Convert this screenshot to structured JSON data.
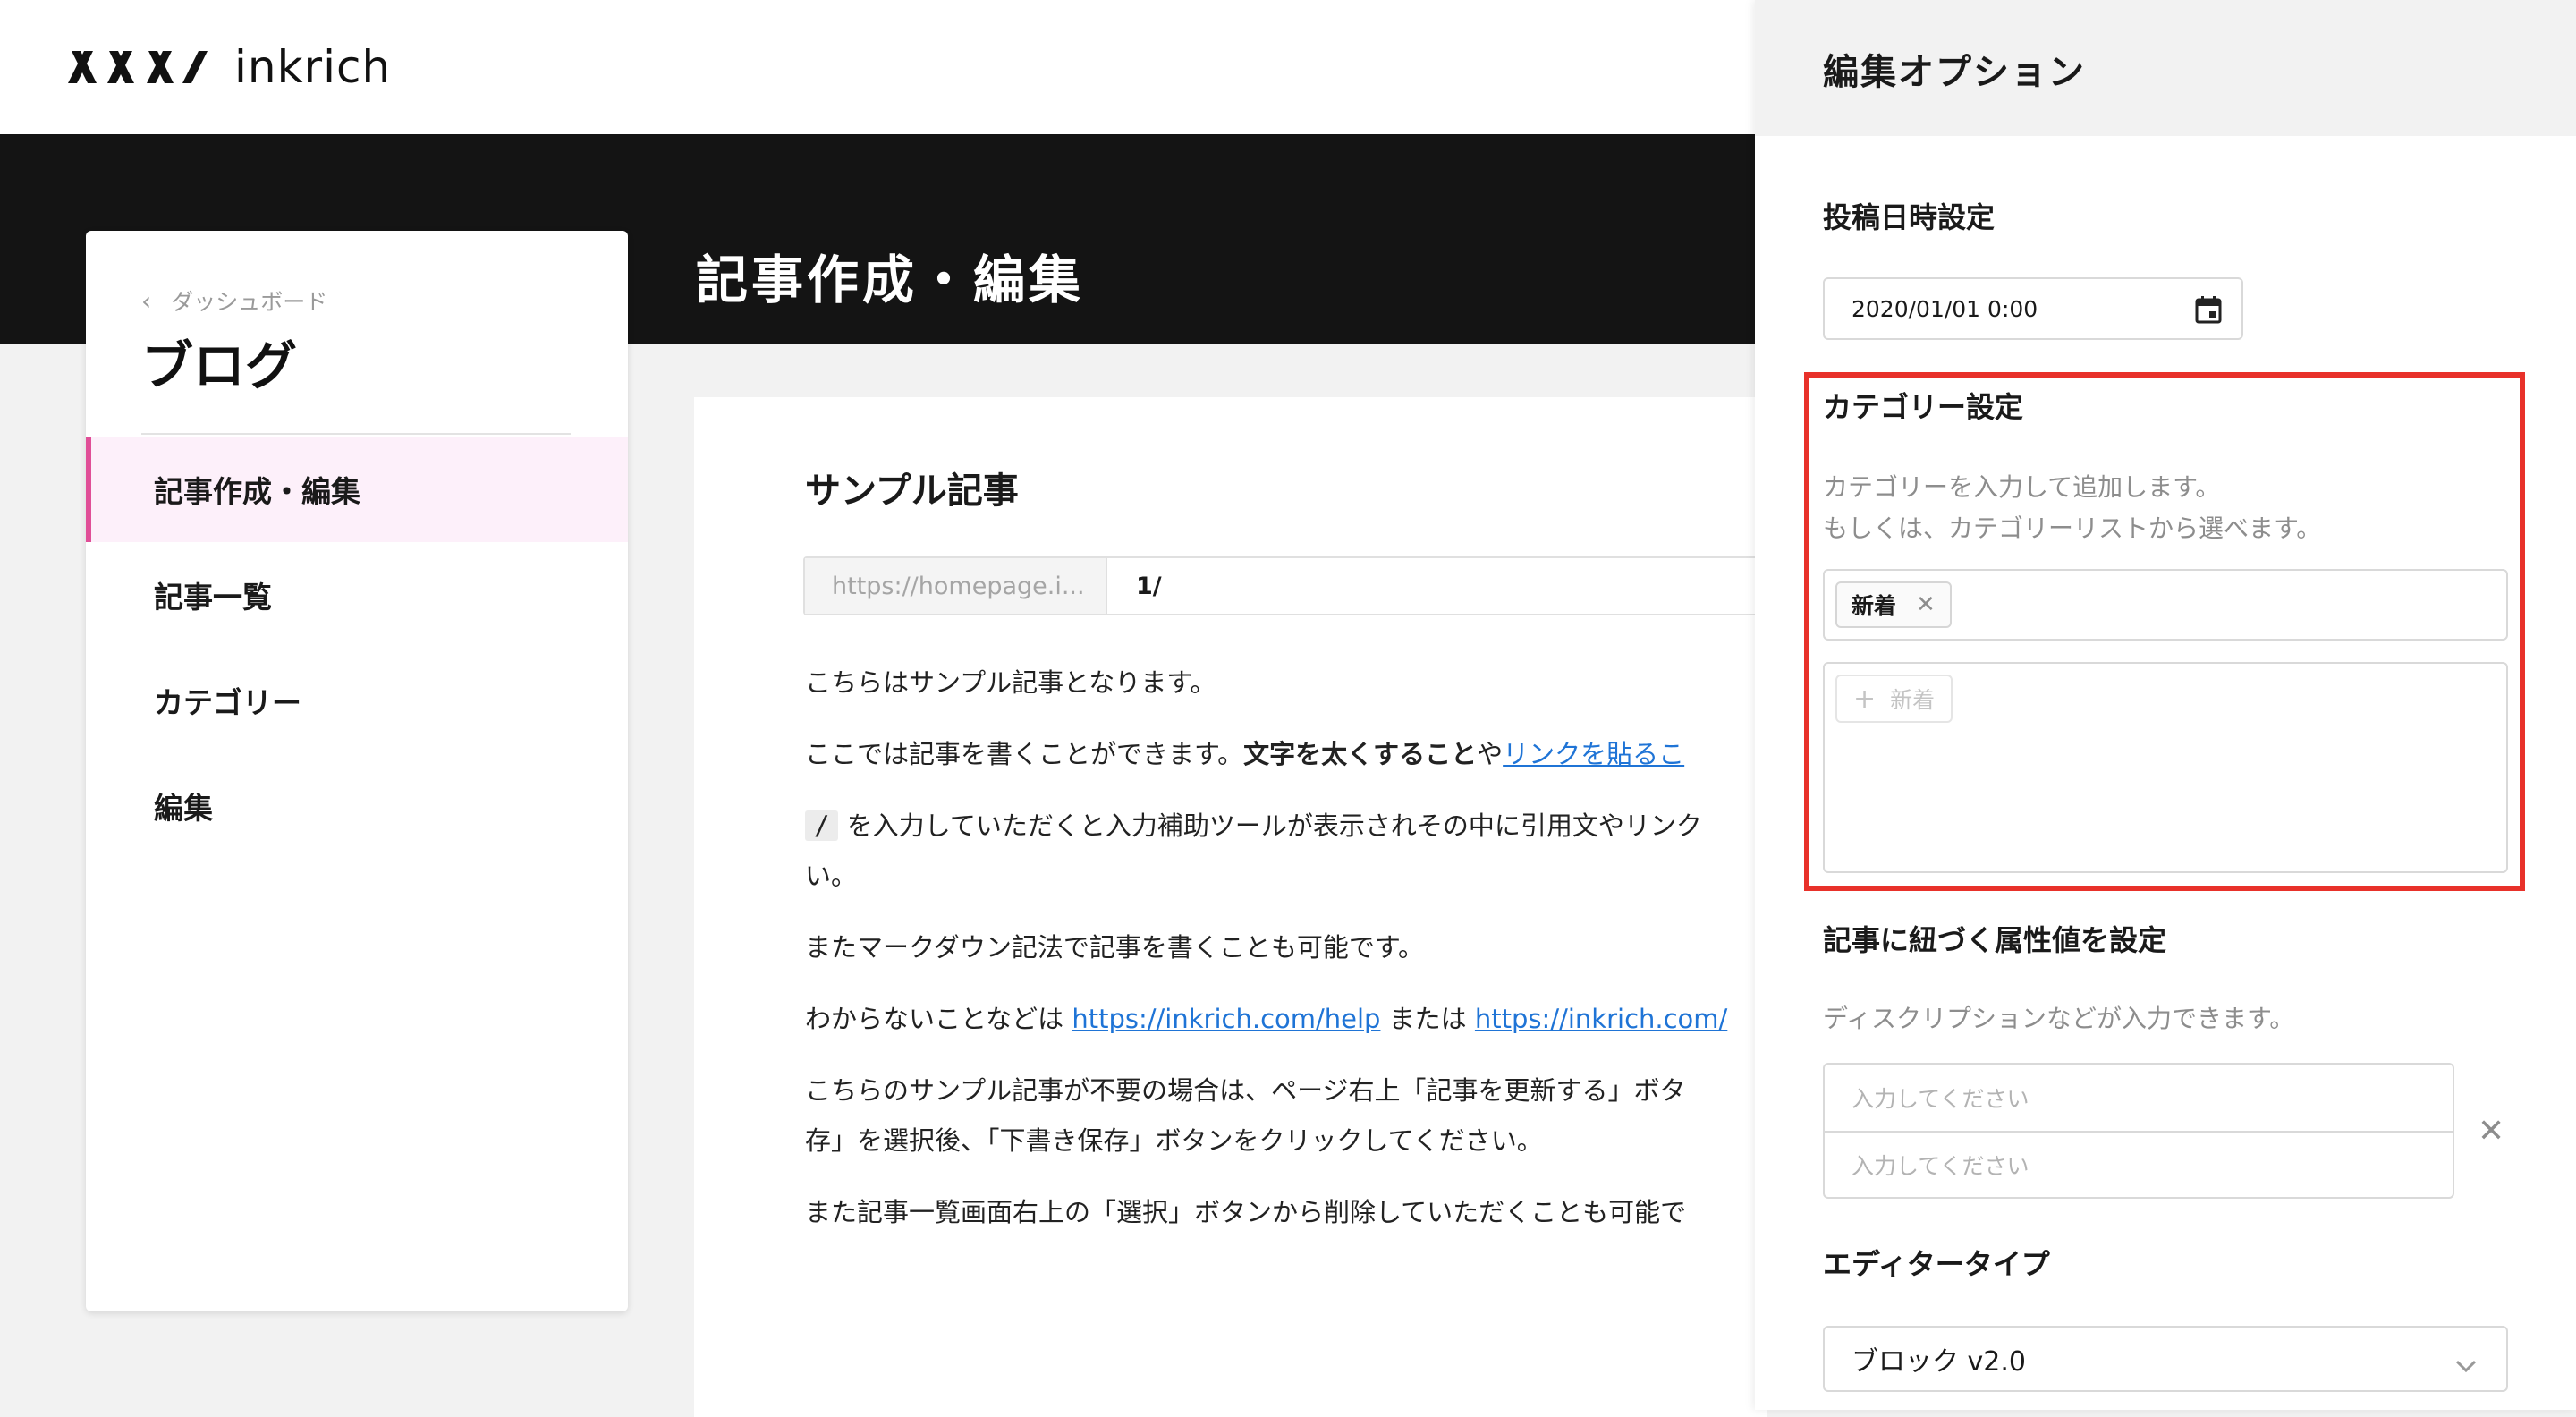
{
  "brand": {
    "name": "inkrich"
  },
  "header": {
    "page_title": "記事作成・編集"
  },
  "sidebar": {
    "back_label": "ダッシュボード",
    "title": "ブログ",
    "items": [
      {
        "label": "記事作成・編集",
        "active": true
      },
      {
        "label": "記事一覧",
        "active": false
      },
      {
        "label": "カテゴリー",
        "active": false
      },
      {
        "label": "編集",
        "active": false
      }
    ]
  },
  "article": {
    "title": "サンプル記事",
    "url_prefix": "https://homepage.i...",
    "url_slug": "1/",
    "p1": "こちらはサンプル記事となります。",
    "p2_a": "ここでは記事を書くことができます。",
    "p2_bold": "文字を太くすること",
    "p2_b": "や",
    "p2_link": "リンクを貼るこ",
    "p3_code": "/",
    "p3_text": " を入力していただくと入力補助ツールが表示されその中に引用文やリンク",
    "p3_cont": "い。",
    "p4": "またマークダウン記法で記事を書くことも可能です。",
    "p5_a": "わからないことなどは ",
    "p5_link1": "https://inkrich.com/help",
    "p5_b": " または ",
    "p5_link2": "https://inkrich.com/",
    "p6_line1": "こちらのサンプル記事が不要の場合は、ページ右上「記事を更新する」ボタ",
    "p6_line2": "存」を選択後、「下書き保存」ボタンをクリックしてください。",
    "p7": "また記事一覧画面右上の「選択」ボタンから削除していただくことも可能で"
  },
  "panel": {
    "title": "編集オプション",
    "post_date": {
      "label": "投稿日時設定",
      "value": "2020/01/01 0:00"
    },
    "category": {
      "label": "カテゴリー設定",
      "desc_line1": "カテゴリーを入力して追加します。",
      "desc_line2": "もしくは、カテゴリーリストから選べます。",
      "selected_tag": "新着",
      "list_item": "新着"
    },
    "attributes": {
      "label": "記事に紐づく属性値を設定",
      "desc": "ディスクリプションなどが入力できます。",
      "key_placeholder": "入力してください",
      "value_placeholder": "入力してください"
    },
    "editor": {
      "label": "エディタータイプ",
      "value": "ブロック v2.0"
    }
  },
  "colors": {
    "accent": "#e04e97",
    "highlight": "#e8312a",
    "link": "#1f74d6"
  }
}
